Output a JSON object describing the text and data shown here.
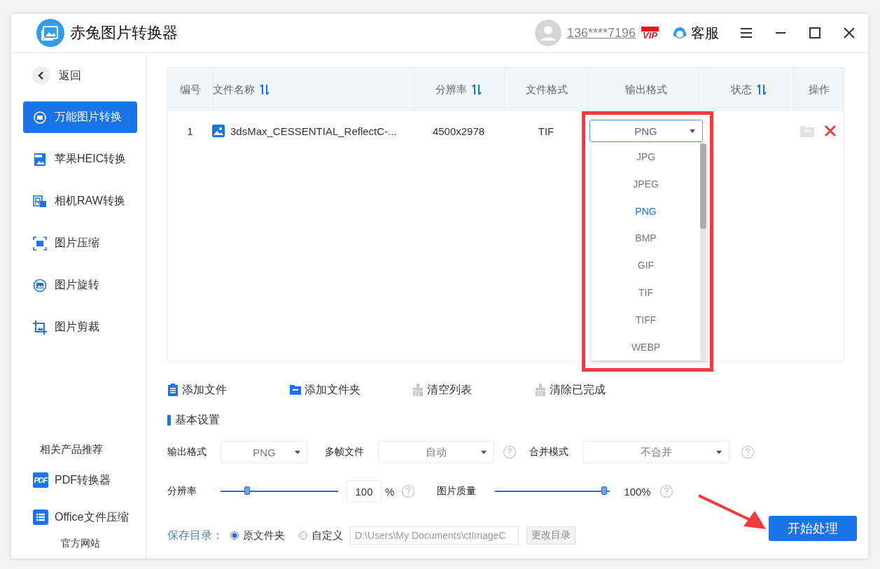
{
  "app": {
    "title": "赤兔图片转换器"
  },
  "header": {
    "user": "136****7196",
    "vip": "VIP",
    "service": "客服"
  },
  "sidebar": {
    "back": "返回",
    "items": [
      {
        "kind": "convert",
        "label": "万能图片转换",
        "selected": true
      },
      {
        "kind": "heic",
        "label": "苹果HEIC转换",
        "selected": false
      },
      {
        "kind": "raw",
        "label": "相机RAW转换",
        "selected": false
      },
      {
        "kind": "compress",
        "label": "图片压缩",
        "selected": false
      },
      {
        "kind": "rotate",
        "label": "图片旋转",
        "selected": false
      },
      {
        "kind": "crop",
        "label": "图片剪裁",
        "selected": false
      }
    ],
    "recommend_title": "相关产品推荐",
    "products": [
      {
        "kind": "pdf",
        "badge": "PDF",
        "label": "PDF转换器"
      },
      {
        "kind": "office",
        "label": "Office文件压缩"
      }
    ],
    "website": "官方网站"
  },
  "table": {
    "columns": [
      {
        "label": "编号",
        "sortable": false
      },
      {
        "label": "文件名称",
        "sortable": true
      },
      {
        "label": "分辨率",
        "sortable": true
      },
      {
        "label": "文件格式",
        "sortable": false
      },
      {
        "label": "输出格式",
        "sortable": false
      },
      {
        "label": "状态",
        "sortable": true
      },
      {
        "label": "操作",
        "sortable": false
      }
    ],
    "rows": [
      {
        "no": "1",
        "name": "3dsMax_CESSENTIAL_ReflectC-...",
        "resolution": "4500x2978",
        "format": "TIF",
        "output": "PNG",
        "expanded": true,
        "options": [
          {
            "label": "JPG",
            "selected": false
          },
          {
            "label": "JPEG",
            "selected": false
          },
          {
            "label": "PNG",
            "selected": true
          },
          {
            "label": "BMP",
            "selected": false
          },
          {
            "label": "GIF",
            "selected": false
          },
          {
            "label": "TIF",
            "selected": false
          },
          {
            "label": "TIFF",
            "selected": false
          },
          {
            "label": "WEBP",
            "selected": false
          }
        ]
      }
    ]
  },
  "actions": [
    {
      "kind": "file",
      "label": "添加文件",
      "disabled": false
    },
    {
      "kind": "folder",
      "label": "添加文件夹",
      "disabled": false
    },
    {
      "kind": "clear",
      "label": "清空列表",
      "disabled": true
    },
    {
      "kind": "clear",
      "label": "清除已完成",
      "disabled": true
    }
  ],
  "settings": {
    "title": "基本设置",
    "selects": [
      {
        "label": "输出格式",
        "value": "PNG",
        "help": false
      },
      {
        "label": "多帧文件",
        "value": "自动",
        "help": true
      },
      {
        "label": "合并模式",
        "value": "不合并",
        "help": true
      }
    ],
    "resolution": {
      "label": "分辨率",
      "level": 0.21,
      "value": "100",
      "unit": "%",
      "help": true
    },
    "quality": {
      "label": "图片质量",
      "level": 0.97,
      "reading": "100%",
      "help": true
    },
    "save": {
      "label": "保存目录：",
      "options": [
        {
          "label": "原文件夹",
          "selected": true
        },
        {
          "label": "自定义",
          "selected": false
        }
      ],
      "path": "D:\\Users\\My Documents\\ctImageC",
      "button": "更改目录"
    }
  },
  "start_button": "开始处理"
}
